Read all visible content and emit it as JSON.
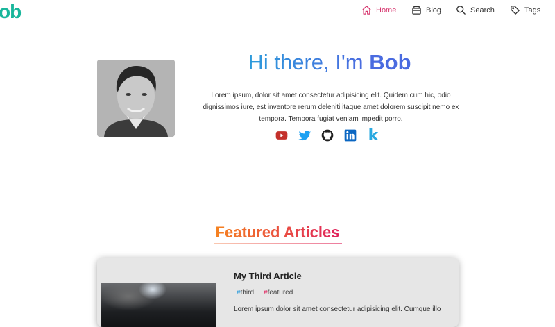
{
  "header": {
    "logo": "ob",
    "nav": [
      {
        "label": "Home",
        "icon": "home-icon",
        "active": true
      },
      {
        "label": "Blog",
        "icon": "archive-icon"
      },
      {
        "label": "Search",
        "icon": "search-icon"
      },
      {
        "label": "Tags",
        "icon": "tag-icon"
      }
    ]
  },
  "hero": {
    "greeting": "Hi there, I'm",
    "name": "Bob",
    "description": "Lorem ipsum, dolor sit amet consectetur adipisicing elit. Quidem cum hic, odio dignissimos iure, est inventore rerum deleniti itaque amet dolorem suscipit nemo ex tempora. Tempora fugiat veniam impedit porro.",
    "socials": [
      "youtube-icon",
      "twitter-icon",
      "github-icon",
      "linkedin-icon",
      "kaggle-icon"
    ],
    "social_k": "k"
  },
  "featured": {
    "title": "Featured Articles",
    "article": {
      "title": "My Third Article",
      "tags": [
        {
          "hash": "#",
          "label": "third"
        },
        {
          "hash": "#",
          "label": "featured"
        }
      ],
      "excerpt": "Lorem ipsum dolor sit amet consectetur adipisicing elit. Cumque illo"
    }
  },
  "colors": {
    "accent": "#d6336c",
    "logo": "#18b69b",
    "title_blue": "#4a6be0",
    "featured_orange": "#f58220",
    "featured_red": "#e0245e"
  }
}
